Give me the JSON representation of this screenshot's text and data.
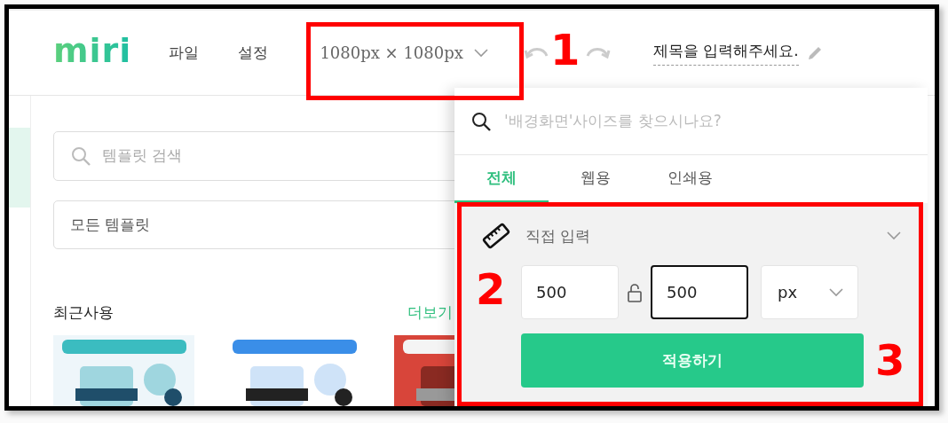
{
  "header": {
    "logo": "miri",
    "menu": [
      {
        "label": "파일"
      },
      {
        "label": "설정"
      }
    ],
    "size_select": {
      "value": "1080px × 1080px"
    },
    "title_field": {
      "placeholder": "제목을 입력해주세요."
    }
  },
  "sidebar": {
    "search": {
      "placeholder": "템플릿 검색"
    },
    "category_select": {
      "value": "모든 템플릿"
    },
    "recent": {
      "heading": "최근사용",
      "more_link": "더보기"
    }
  },
  "size_dropdown": {
    "search": {
      "placeholder": "'배경화면'사이즈를 찾으시나요?"
    },
    "tabs": [
      {
        "label": "전체",
        "selected": true
      },
      {
        "label": "웹용",
        "selected": false
      },
      {
        "label": "인쇄용",
        "selected": false
      }
    ],
    "custom": {
      "label": "직접 입력",
      "expanded": true,
      "fields": [
        {
          "value": "500",
          "focused": false
        },
        {
          "value": "500",
          "focused": true
        }
      ],
      "locked": false,
      "unit": "px",
      "apply_button": "적용하기"
    }
  },
  "annotations": [
    {
      "label": "1"
    },
    {
      "label": "2"
    },
    {
      "label": "3"
    }
  ]
}
